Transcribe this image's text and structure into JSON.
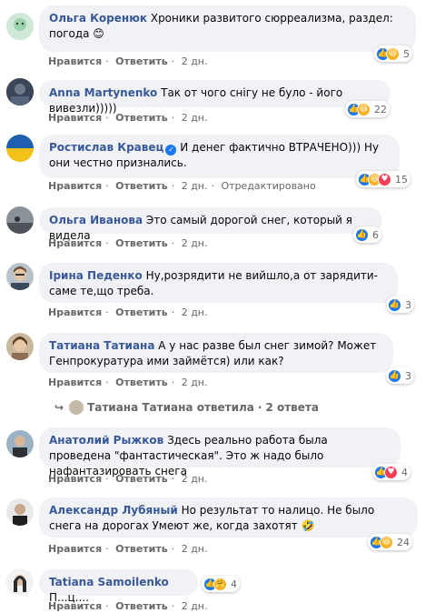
{
  "actions": {
    "like": "Нравится",
    "reply": "Ответить",
    "time": "2 дн.",
    "edited": "Отредактировано"
  },
  "comments": [
    {
      "author": "Ольга Коренюк",
      "text": "Хроники развитого сюрреализма, раздел: погода 😊",
      "count": "5",
      "reactions": [
        "like",
        "haha"
      ]
    },
    {
      "author": "Anna Martynenko",
      "text": "Так от чого снігу не було - його вивезли)))))",
      "count": "22",
      "reactions": [
        "like",
        "haha"
      ]
    },
    {
      "author": "Ростислав Кравец",
      "text": "И денег фактично ВТРАЧЕНО))) Ну они честно признались.",
      "count": "15",
      "reactions": [
        "like",
        "haha",
        "love"
      ]
    },
    {
      "author": "Ольга Иванова",
      "text": "Это самый дорогой снег, который я видела",
      "count": "6",
      "reactions": [
        "like"
      ]
    },
    {
      "author": "Ірина Педенко",
      "text": "Ну,розрядити не вийшло,а от зарядити-саме те,що треба.",
      "count": "3",
      "reactions": [
        "like"
      ]
    },
    {
      "author": "Татиана Татиана",
      "text": "А у нас разве был снег зимой? Может Генпрокуратура ими займётся) или как?",
      "count": "3",
      "reactions": [
        "like"
      ]
    },
    {
      "author": "Анатолий Рыжков",
      "text": "Здесь реально работа была проведена \"фантастическая\". Это ж надо было нафантазировать снега",
      "count": "4",
      "reactions": [
        "like",
        "love"
      ]
    },
    {
      "author": "Александр Лубяный",
      "text": "Но результат то налицо. Не было снега на дорогах Умеют же, когда захотят 🤣",
      "count": "24",
      "reactions": [
        "like",
        "haha"
      ]
    },
    {
      "author": "Tatiana Samoilenko",
      "text": "П...ц....",
      "count": "4",
      "reactions": [
        "like",
        "care"
      ]
    }
  ],
  "replies_line": {
    "author": "Татиана Татиана",
    "action": "ответила",
    "count": "2 ответа"
  },
  "icons": {
    "like": "thumbs-up-icon",
    "haha": "laughing-face-icon",
    "love": "heart-icon",
    "care": "care-face-icon"
  }
}
